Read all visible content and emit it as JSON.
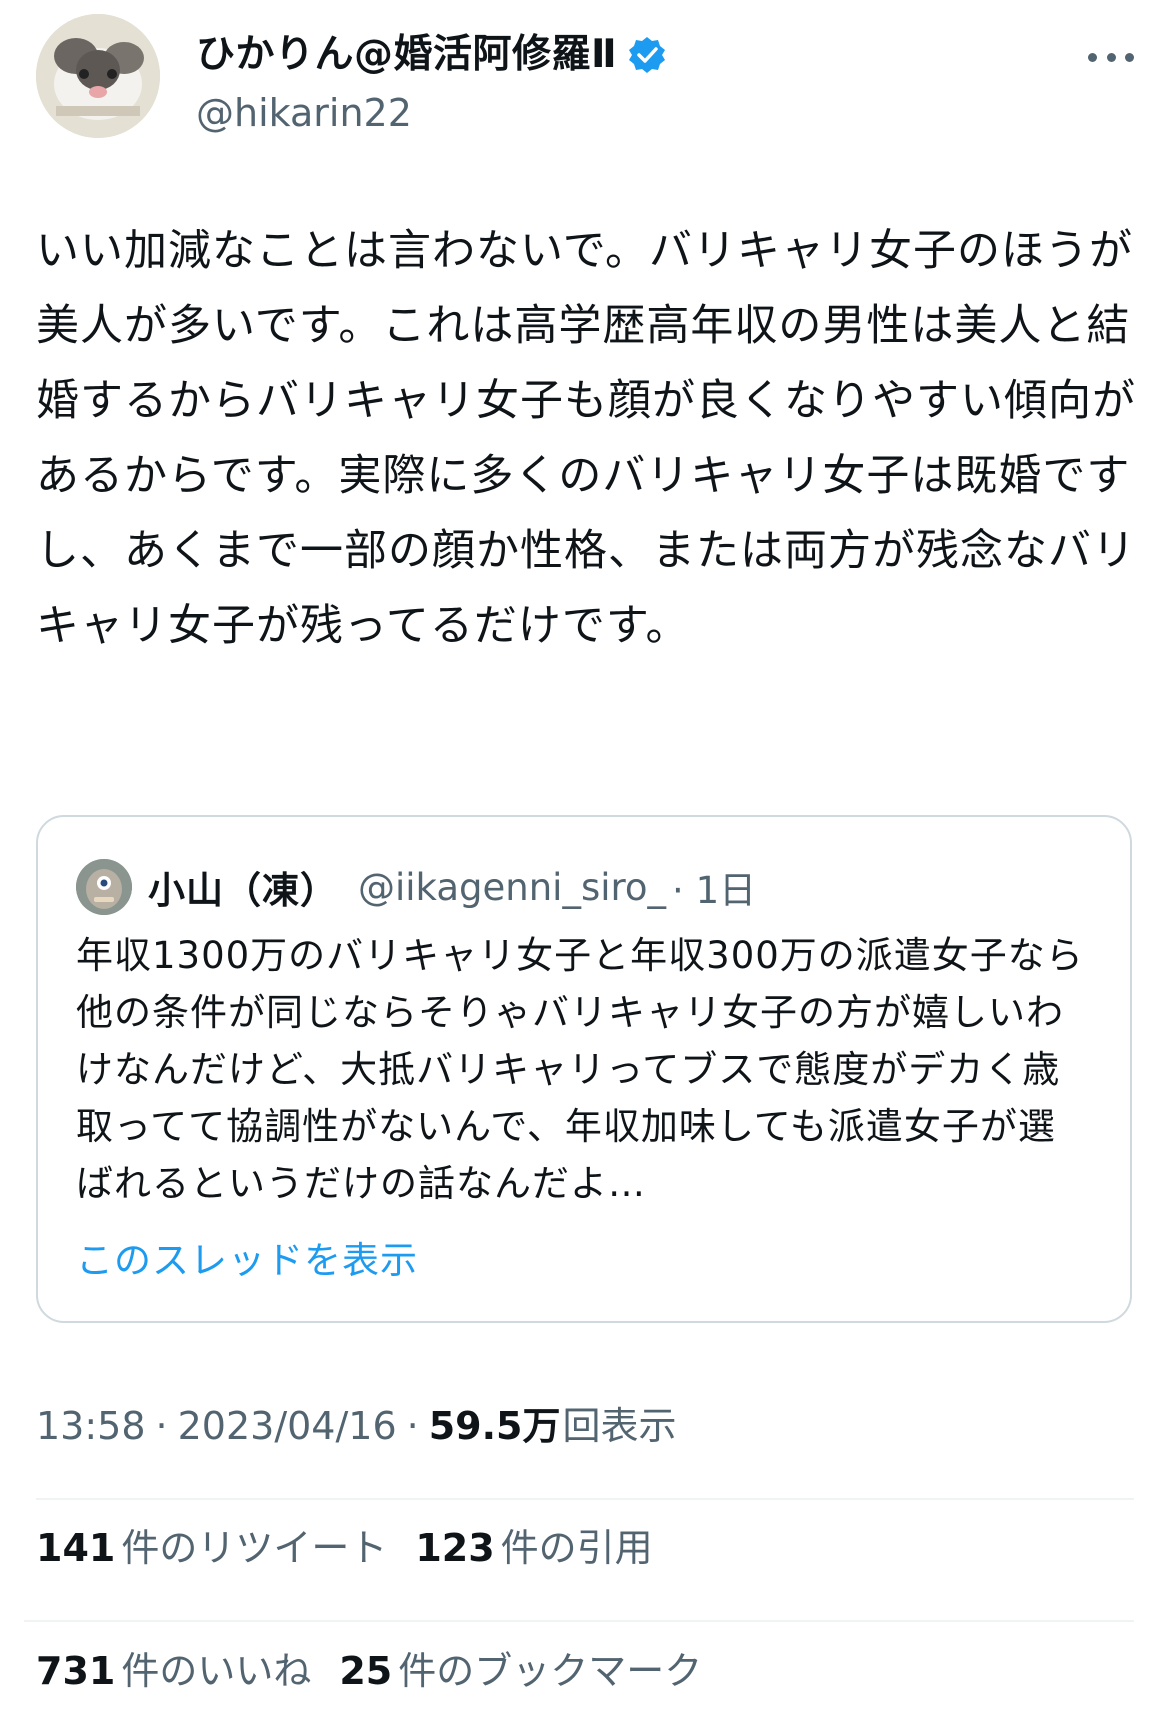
{
  "author": {
    "display_name": "ひかりん@婚活阿修羅Ⅱ",
    "handle": "@hikarin22"
  },
  "tweet": {
    "text": "いい加減なことは言わないで。バリキャリ女子のほうが美人が多いです。これは高学歴高年収の男性は美人と結婚するからバリキャリ女子も顔が良くなりやすい傾向があるからです。実際に多くのバリキャリ女子は既婚ですし、あくまで一部の顔か性格、または両方が残念なバリキャリ女子が残ってるだけです。",
    "time": "13:58",
    "date": "2023/04/16",
    "views_count": "59.5万",
    "views_label": "回表示",
    "separator": "·"
  },
  "quoted": {
    "display_name": "小山（凍）",
    "handle": "@iikagenni_siro_",
    "age": "· 1日",
    "text": "年収1300万のバリキャリ女子と年収300万の派遣女子なら他の条件が同じならそりゃバリキャリ女子の方が嬉しいわけなんだけど、大抵バリキャリってブスで態度がデカく歳取ってて協調性がないんで、年収加味しても派遣女子が選ばれるというだけの話なんだよ…",
    "show_thread": "このスレッドを表示"
  },
  "stats": {
    "retweets_count": "141",
    "retweets_label": "件のリツイート",
    "quotes_count": "123",
    "quotes_label": "件の引用",
    "likes_count": "731",
    "likes_label": "件のいいね",
    "bookmarks_count": "25",
    "bookmarks_label": "件のブックマーク"
  },
  "colors": {
    "accent": "#1d9bf0",
    "secondary_text": "#536471",
    "border": "#cfd9de"
  },
  "icons": {
    "verified": "verified-badge-icon",
    "more": "more-options-icon"
  }
}
